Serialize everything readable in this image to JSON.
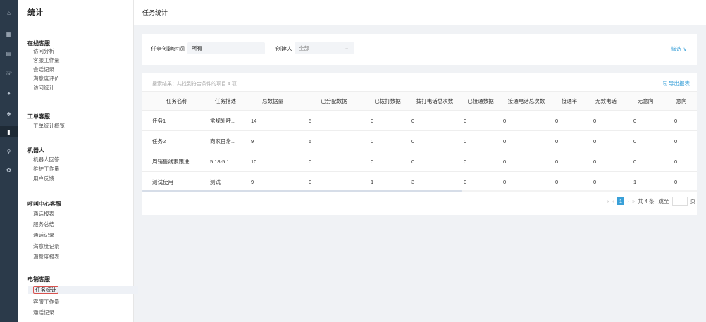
{
  "rail": {
    "icons": [
      "home-icon",
      "grid-icon",
      "book-icon",
      "phone-icon",
      "user-icon",
      "team-icon",
      "chart-icon",
      "search-icon",
      "settings-icon"
    ],
    "glyphs": [
      "⌂",
      "▦",
      "▤",
      "☏",
      "●",
      "♣",
      "▮",
      "⚲",
      "✿"
    ]
  },
  "sidebar": {
    "title": "统计",
    "groups": [
      {
        "label": "在线客服",
        "items": [
          "访问分析",
          "客服工作量",
          "会话记录",
          "满意度评价",
          "访问统计"
        ]
      },
      {
        "label": "工单客服",
        "items": [
          "工单统计概览"
        ]
      },
      {
        "label": "机器人",
        "items": [
          "机器人回答",
          "维护工作量",
          "用户反馈"
        ]
      },
      {
        "label": "呼叫中心客服",
        "items": [
          "通话报表",
          "服务总结",
          "通话记录",
          "满意度记录",
          "满意度报表"
        ]
      },
      {
        "label": "电销客服",
        "items": [
          "任务统计",
          "客服工作量",
          "通话记录"
        ]
      }
    ]
  },
  "header": {
    "title": "任务统计"
  },
  "filter": {
    "time_label": "任务创建时间",
    "time_value": "所有",
    "creator_label": "创建人",
    "creator_value": "全部",
    "screen_label": "筛选 ∨"
  },
  "results": {
    "info": "搜索结果：共找到符合条件的项目 4 项",
    "export_label": "⎘ 导出报表"
  },
  "table": {
    "columns": [
      "任务名称",
      "任务描述",
      "总数据量",
      "已分配数据",
      "已拨打数据",
      "拨打电话总次数",
      "已接通数据",
      "接通电话总次数",
      "接通率",
      "无效电话",
      "无意向",
      "意向"
    ],
    "rows": [
      [
        "任务1",
        "常规外呼...",
        "14",
        "5",
        "0",
        "0",
        "0",
        "0",
        "0",
        "0",
        "0",
        "0"
      ],
      [
        "任务2",
        "商家日常...",
        "9",
        "5",
        "0",
        "0",
        "0",
        "0",
        "0",
        "0",
        "0",
        "0"
      ],
      [
        "周销售线索跟进",
        "5.18-5.1...",
        "10",
        "0",
        "0",
        "0",
        "0",
        "0",
        "0",
        "0",
        "0",
        "0"
      ],
      [
        "测试使用",
        "测试",
        "9",
        "0",
        "1",
        "3",
        "0",
        "0",
        "0",
        "0",
        "1",
        "0"
      ]
    ]
  },
  "pager": {
    "prev_first": "«",
    "prev": "‹",
    "current": "1",
    "next": "›",
    "next_last": "»",
    "total": "共 4 条",
    "jump_label": "跳至",
    "page_suffix": "页"
  },
  "colors": {
    "accent": "#3aa0d8",
    "rail": "#2b3a4a",
    "selected_outline": "#d9534f"
  }
}
